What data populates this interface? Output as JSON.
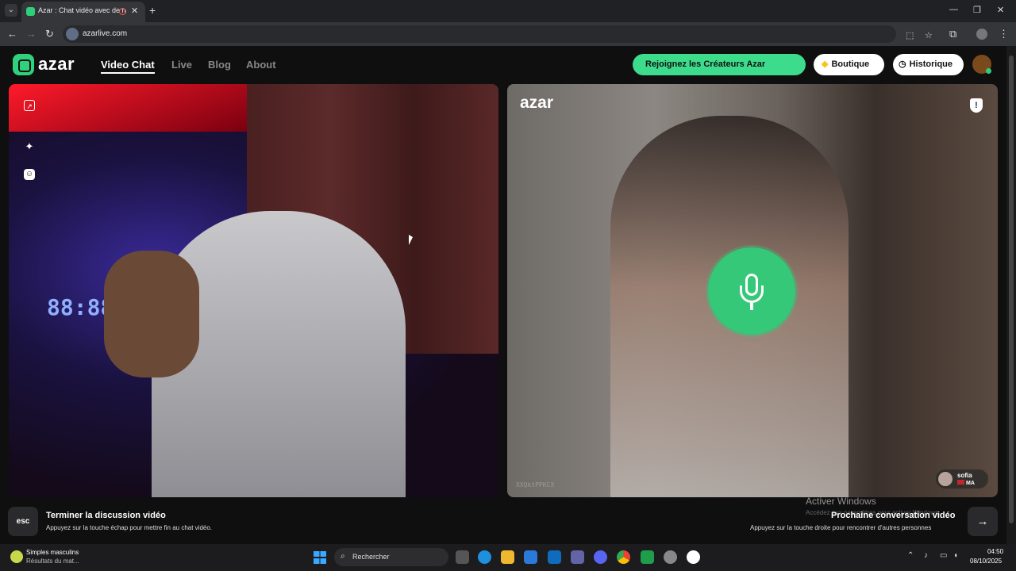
{
  "browser": {
    "tab_title": "Azar : Chat vidéo avec de n",
    "url": "azarlive.com"
  },
  "header": {
    "logo": "azar",
    "nav": [
      {
        "label": "Video Chat"
      },
      {
        "label": "Live"
      },
      {
        "label": "Blog"
      },
      {
        "label": "About"
      }
    ],
    "creators_button": "Rejoignez les Créateurs Azar",
    "shop_button": "Boutique",
    "history_button": "Historique"
  },
  "left_video": {
    "clock_display": "88:88"
  },
  "right_video": {
    "logo": "azar",
    "session_id": "XXQktPPKCX",
    "user": {
      "name": "sofia",
      "country": "MA"
    }
  },
  "bottom": {
    "esc_key": "esc",
    "end_title": "Terminer la discussion vidéo",
    "end_sub": "Appuyez sur la touche échap pour mettre fin au chat vidéo.",
    "next_title": "Prochaine conversation vidéo",
    "next_sub": "Appuyez sur la touche droite pour rencontrer d'autres personnes",
    "next_key": "→"
  },
  "windows_watermark": {
    "title": "Activer Windows",
    "sub": "Accédez aux paramètres pour activer Windows."
  },
  "taskbar": {
    "weather_title": "Simples masculins",
    "weather_sub": "Résultats du mat...",
    "search_placeholder": "Rechercher",
    "time": "04:50",
    "date": "08/10/2025"
  },
  "colors": {
    "brand_green": "#3ddc8c",
    "mic_green": "#34c878",
    "background": "#0f0f10"
  }
}
